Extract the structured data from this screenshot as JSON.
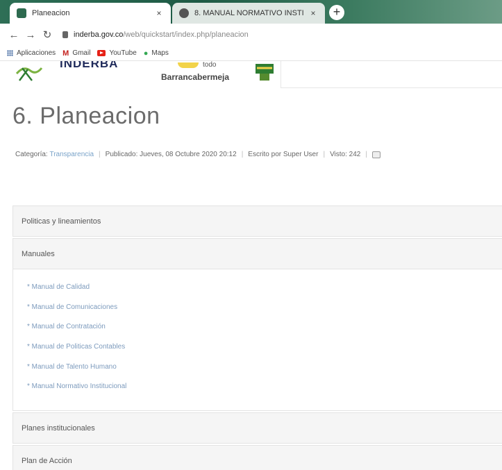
{
  "browser": {
    "tabs": [
      {
        "title": "Planeacion",
        "close": "×"
      },
      {
        "title": "8. MANUAL NORMATIVO INSTI",
        "close": "×"
      }
    ],
    "new_tab": "+",
    "url_host": "inderba.gov.co",
    "url_path": "/web/quickstart/index.php/planeacion",
    "bookmarks": [
      {
        "label": "Aplicaciones",
        "icon": "apps-grid-icon"
      },
      {
        "label": "Gmail",
        "icon": "gmail-icon"
      },
      {
        "label": "YouTube",
        "icon": "youtube-icon"
      },
      {
        "label": "Maps",
        "icon": "maps-icon"
      }
    ]
  },
  "site": {
    "logo_text": "INDERBA",
    "municipality_small": "todo",
    "municipality_name": "Barrancabermeja"
  },
  "article": {
    "title": "6. Planeacion",
    "meta": {
      "category_label": "Categoría:",
      "category_link": "Transparencia",
      "published": "Publicado: Jueves, 08 Octubre 2020 20:12",
      "author": "Escrito por Super User",
      "hits": "Visto: 242"
    }
  },
  "accordion": {
    "sections": [
      "Politicas y lineamientos",
      "Manuales",
      "Planes institucionales",
      "Plan de Acción"
    ],
    "manuales_links": [
      "* Manual de Calidad",
      "* Manual de Comunicaciones",
      "* Manual de Contratación",
      "* Manual de Politicas Contables",
      "* Manual de Talento Humano",
      "* Manual Normativo Institucional"
    ]
  },
  "colors": {
    "tabstrip": "#2e6f56",
    "link": "#7d9bbd",
    "title": "#6b6b6b"
  }
}
